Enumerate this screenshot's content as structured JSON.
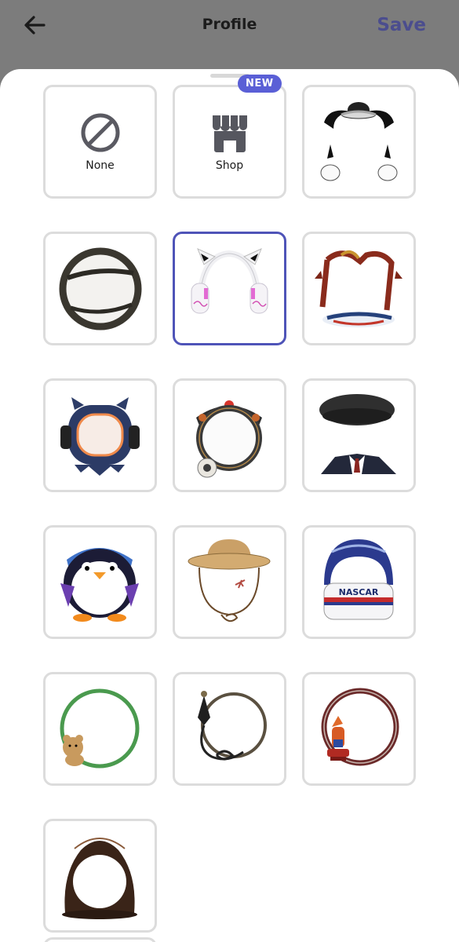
{
  "header": {
    "title": "Profile",
    "save_label": "Save"
  },
  "tiles": {
    "none": {
      "label": "None"
    },
    "shop": {
      "label": "Shop",
      "badge": "NEW"
    },
    "racing": {
      "helmet_text": "NASCAR"
    }
  },
  "selected_tile": "cat-ears-headphones",
  "colors": {
    "accent": "#5a5fd6",
    "selected_border": "#4f54b8",
    "save": "#4b4d8e"
  }
}
